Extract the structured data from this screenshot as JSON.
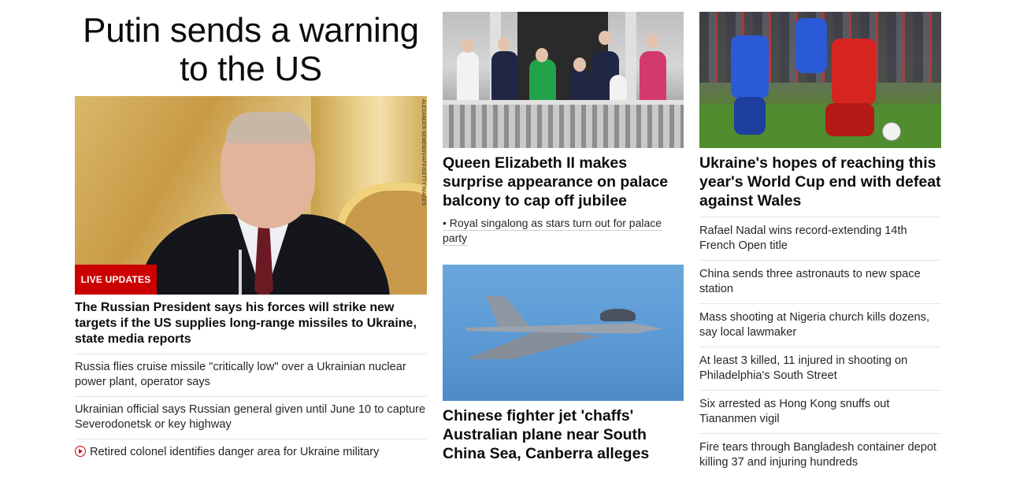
{
  "lead": {
    "headline": "Putin sends a warning to the US",
    "photo_credit": "ALEXANDER NEMENOV/AFP/GETTY IMAGES",
    "badge": "LIVE UPDATES",
    "summary": "The Russian President says his forces will strike new targets if the US supplies long-range missiles to Ukraine, state media reports",
    "related": [
      "Russia flies cruise missile \"critically low\" over a Ukrainian nuclear power plant, operator says",
      "Ukrainian official says Russian general given until June 10 to capture Severodonetsk or key highway",
      "Retired colonel identifies danger area for Ukraine military"
    ]
  },
  "middle": {
    "story1": {
      "headline": "Queen Elizabeth II makes surprise appearance on palace balcony to cap off jubilee",
      "bullet": "• Royal singalong as stars turn out for palace party"
    },
    "story2": {
      "headline": "Chinese fighter jet 'chaffs' Australian plane near South China Sea, Canberra alleges"
    }
  },
  "right": {
    "headline": "Ukraine's hopes of reaching this year's World Cup end with defeat against Wales",
    "links": [
      "Rafael Nadal wins record-extending 14th French Open title",
      "China sends three astronauts to new space station",
      "Mass shooting at Nigeria church kills dozens, say local lawmaker",
      "At least 3 killed, 11 injured in shooting on Philadelphia's South Street",
      "Six arrested as Hong Kong snuffs out Tiananmen vigil",
      "Fire tears through Bangladesh container depot killing 37 and injuring hundreds"
    ]
  },
  "colors": {
    "accent_red": "#cc0000",
    "text": "#0c0c0c",
    "divider": "#e6e6e6"
  }
}
